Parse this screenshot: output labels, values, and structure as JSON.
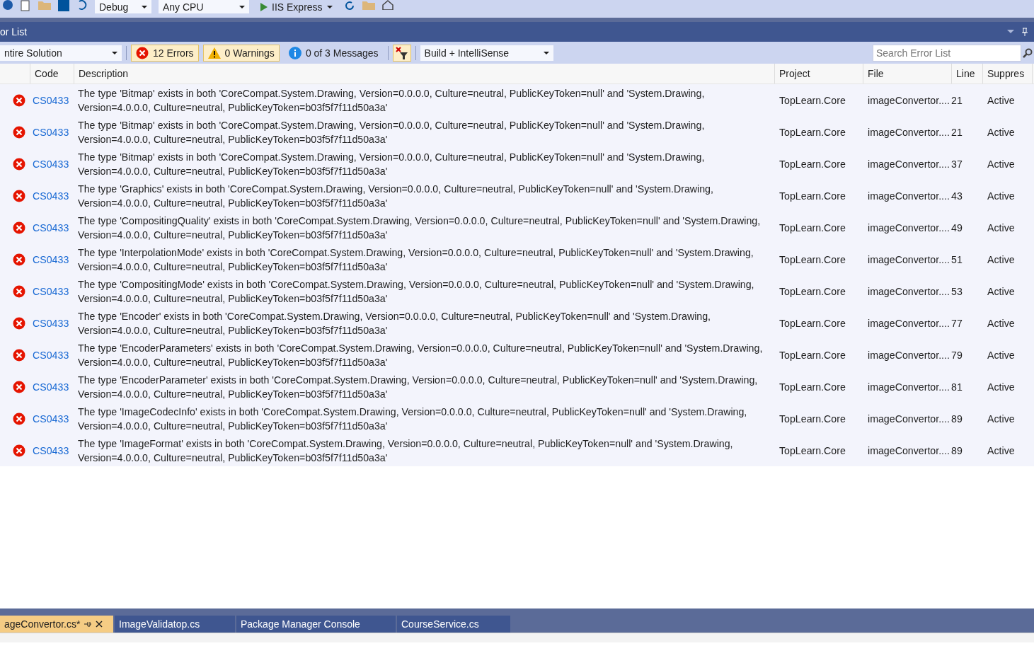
{
  "toolbar": {
    "configuration": "Debug",
    "platform": "Any CPU",
    "run_target": "IIS Express"
  },
  "panel": {
    "title": "or List",
    "scope": "ntire Solution",
    "filters": [
      {
        "kind": "error",
        "label": "12 Errors",
        "selected": true
      },
      {
        "kind": "warning",
        "label": "0 Warnings",
        "selected": true
      },
      {
        "kind": "info",
        "label": "0 of 3 Messages",
        "selected": false
      }
    ],
    "build_filter": "Build + IntelliSense",
    "search": {
      "placeholder": "Search Error List"
    }
  },
  "table": {
    "columns": [
      "Code",
      "Description",
      "Project",
      "File",
      "Line",
      "Suppres"
    ],
    "rows": [
      {
        "code": "CS0433",
        "description": "The type 'Bitmap' exists in both 'CoreCompat.System.Drawing, Version=0.0.0.0, Culture=neutral, PublicKeyToken=null' and 'System.Drawing, Version=4.0.0.0, Culture=neutral, PublicKeyToken=b03f5f7f11d50a3a'",
        "project": "TopLearn.Core",
        "file": "imageConvertor....",
        "line": "21",
        "suppression": "Active"
      },
      {
        "code": "CS0433",
        "description": "The type 'Bitmap' exists in both 'CoreCompat.System.Drawing, Version=0.0.0.0, Culture=neutral, PublicKeyToken=null' and 'System.Drawing, Version=4.0.0.0, Culture=neutral, PublicKeyToken=b03f5f7f11d50a3a'",
        "project": "TopLearn.Core",
        "file": "imageConvertor....",
        "line": "21",
        "suppression": "Active"
      },
      {
        "code": "CS0433",
        "description": "The type 'Bitmap' exists in both 'CoreCompat.System.Drawing, Version=0.0.0.0, Culture=neutral, PublicKeyToken=null' and 'System.Drawing, Version=4.0.0.0, Culture=neutral, PublicKeyToken=b03f5f7f11d50a3a'",
        "project": "TopLearn.Core",
        "file": "imageConvertor....",
        "line": "37",
        "suppression": "Active"
      },
      {
        "code": "CS0433",
        "description": "The type 'Graphics' exists in both 'CoreCompat.System.Drawing, Version=0.0.0.0, Culture=neutral, PublicKeyToken=null' and 'System.Drawing, Version=4.0.0.0, Culture=neutral, PublicKeyToken=b03f5f7f11d50a3a'",
        "project": "TopLearn.Core",
        "file": "imageConvertor....",
        "line": "43",
        "suppression": "Active"
      },
      {
        "code": "CS0433",
        "description": "The type 'CompositingQuality' exists in both 'CoreCompat.System.Drawing, Version=0.0.0.0, Culture=neutral, PublicKeyToken=null' and 'System.Drawing, Version=4.0.0.0, Culture=neutral, PublicKeyToken=b03f5f7f11d50a3a'",
        "project": "TopLearn.Core",
        "file": "imageConvertor....",
        "line": "49",
        "suppression": "Active"
      },
      {
        "code": "CS0433",
        "description": "The type 'InterpolationMode' exists in both 'CoreCompat.System.Drawing, Version=0.0.0.0, Culture=neutral, PublicKeyToken=null' and 'System.Drawing, Version=4.0.0.0, Culture=neutral, PublicKeyToken=b03f5f7f11d50a3a'",
        "project": "TopLearn.Core",
        "file": "imageConvertor....",
        "line": "51",
        "suppression": "Active"
      },
      {
        "code": "CS0433",
        "description": "The type 'CompositingMode' exists in both 'CoreCompat.System.Drawing, Version=0.0.0.0, Culture=neutral, PublicKeyToken=null' and 'System.Drawing, Version=4.0.0.0, Culture=neutral, PublicKeyToken=b03f5f7f11d50a3a'",
        "project": "TopLearn.Core",
        "file": "imageConvertor....",
        "line": "53",
        "suppression": "Active"
      },
      {
        "code": "CS0433",
        "description": "The type 'Encoder' exists in both 'CoreCompat.System.Drawing, Version=0.0.0.0, Culture=neutral, PublicKeyToken=null' and 'System.Drawing, Version=4.0.0.0, Culture=neutral, PublicKeyToken=b03f5f7f11d50a3a'",
        "project": "TopLearn.Core",
        "file": "imageConvertor....",
        "line": "77",
        "suppression": "Active"
      },
      {
        "code": "CS0433",
        "description": "The type 'EncoderParameters' exists in both 'CoreCompat.System.Drawing, Version=0.0.0.0, Culture=neutral, PublicKeyToken=null' and 'System.Drawing, Version=4.0.0.0, Culture=neutral, PublicKeyToken=b03f5f7f11d50a3a'",
        "project": "TopLearn.Core",
        "file": "imageConvertor....",
        "line": "79",
        "suppression": "Active"
      },
      {
        "code": "CS0433",
        "description": "The type 'EncoderParameter' exists in both 'CoreCompat.System.Drawing, Version=0.0.0.0, Culture=neutral, PublicKeyToken=null' and 'System.Drawing, Version=4.0.0.0, Culture=neutral, PublicKeyToken=b03f5f7f11d50a3a'",
        "project": "TopLearn.Core",
        "file": "imageConvertor....",
        "line": "81",
        "suppression": "Active"
      },
      {
        "code": "CS0433",
        "description": "The type 'ImageCodecInfo' exists in both 'CoreCompat.System.Drawing, Version=0.0.0.0, Culture=neutral, PublicKeyToken=null' and 'System.Drawing, Version=4.0.0.0, Culture=neutral, PublicKeyToken=b03f5f7f11d50a3a'",
        "project": "TopLearn.Core",
        "file": "imageConvertor....",
        "line": "89",
        "suppression": "Active"
      },
      {
        "code": "CS0433",
        "description": "The type 'ImageFormat' exists in both 'CoreCompat.System.Drawing, Version=0.0.0.0, Culture=neutral, PublicKeyToken=null' and 'System.Drawing, Version=4.0.0.0, Culture=neutral, PublicKeyToken=b03f5f7f11d50a3a'",
        "project": "TopLearn.Core",
        "file": "imageConvertor....",
        "line": "89",
        "suppression": "Active"
      }
    ]
  },
  "document_tabs": [
    {
      "label": "ageConvertor.cs*",
      "selected": true
    },
    {
      "label": "ImageValidatop.cs",
      "selected": false
    },
    {
      "label": "Package Manager Console",
      "selected": false
    },
    {
      "label": "CourseService.cs",
      "selected": false
    }
  ]
}
